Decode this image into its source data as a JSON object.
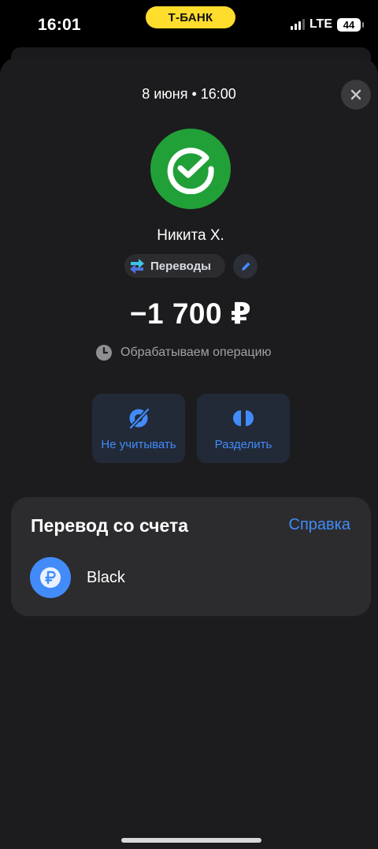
{
  "status_bar": {
    "time": "16:01",
    "island_label": "Т-БАНК",
    "network": "LTE",
    "battery": "44"
  },
  "transaction": {
    "date": "8 июня • 16:00",
    "counterparty": "Никита Х.",
    "category": "Переводы",
    "amount": "−1 700 ₽",
    "status": "Обрабатываем операцию"
  },
  "actions": {
    "ignore_label": "Не учитывать",
    "split_label": "Разделить"
  },
  "account_section": {
    "title": "Перевод со счета",
    "help_link": "Справка",
    "account_name": "Black"
  },
  "colors": {
    "accent": "#428bf9",
    "bank_yellow": "#ffdd2d",
    "counterparty_green": "#21a038",
    "sheet_bg": "#1c1c1e",
    "card_bg": "#2c2c2e"
  },
  "icons": {
    "close": "close-icon",
    "avatar": "sber-logo-icon",
    "category": "transfer-arrows-icon",
    "edit": "pencil-icon",
    "status": "clock-icon",
    "ignore": "eye-off-icon",
    "split": "split-icon",
    "account": "ruble-icon"
  }
}
